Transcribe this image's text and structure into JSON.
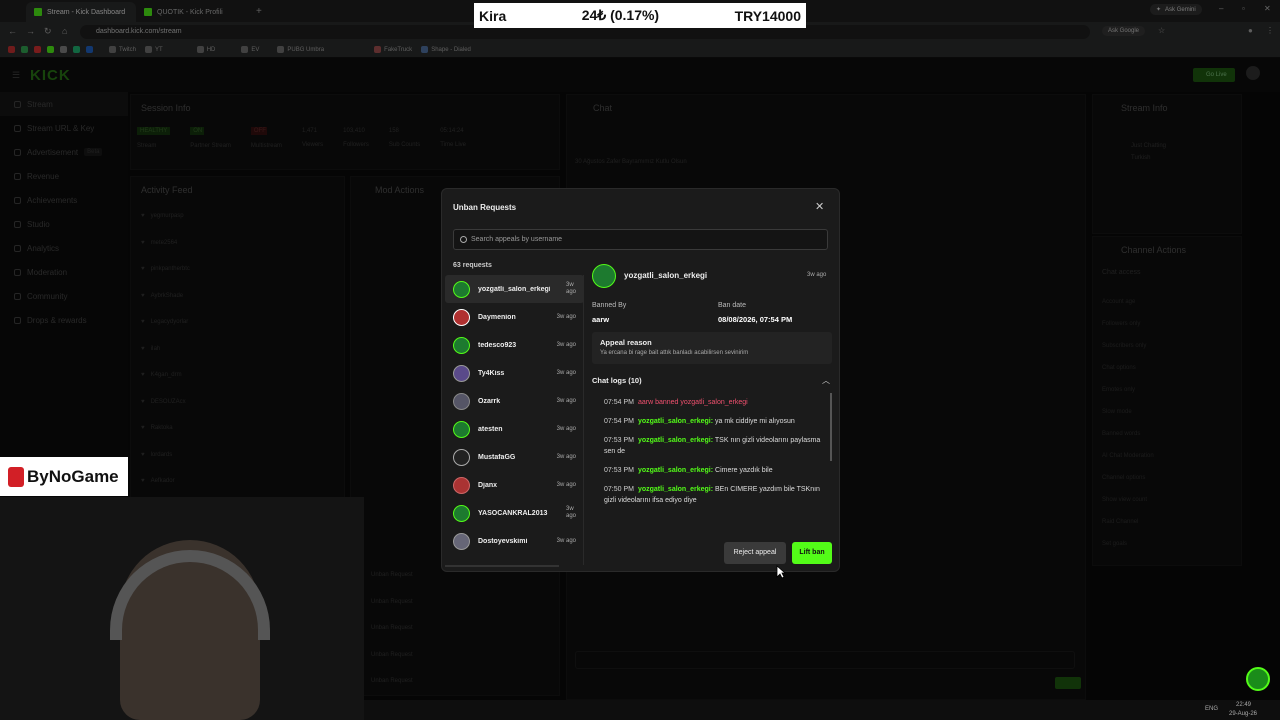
{
  "browser": {
    "tabs": [
      {
        "title": "Stream - Kick Dashboard",
        "active": true
      },
      {
        "title": "QUOTIK - Kick Profili",
        "active": false
      }
    ],
    "url": "dashboard.kick.com/stream",
    "ask_gemini": "Ask Gemini",
    "ask_google": "Ask Google",
    "bookmarks": [
      "Twitch",
      "YT",
      "HD",
      "EV",
      "PUBG Umbra",
      "FakeTruck",
      "Shape - Dialed"
    ]
  },
  "ticker": {
    "name": "Kira",
    "change": "24₺ (0.17%)",
    "amount": "TRY14000"
  },
  "dashboard": {
    "go_live": "Go Live",
    "sidebar": [
      {
        "label": "Stream",
        "selected": true
      },
      {
        "label": "Stream URL & Key",
        "selected": false
      },
      {
        "label": "Advertisement",
        "badge": "Beta",
        "selected": false
      },
      {
        "label": "Revenue",
        "selected": false
      },
      {
        "label": "Achievements",
        "selected": false
      },
      {
        "label": "Studio",
        "selected": false
      },
      {
        "label": "Analytics",
        "selected": false
      },
      {
        "label": "Moderation",
        "selected": false
      },
      {
        "label": "Community",
        "selected": false
      },
      {
        "label": "Drops & rewards",
        "selected": false
      }
    ],
    "session_info": {
      "title": "Session Info",
      "stats": [
        {
          "value": "HEALTHY",
          "label": "Stream"
        },
        {
          "value": "ON",
          "label": "Partner Stream"
        },
        {
          "value": "OFF",
          "label": "Multistream"
        },
        {
          "value": "1,471",
          "label": "Viewers"
        },
        {
          "value": "103,410",
          "label": "Followers"
        },
        {
          "value": "158",
          "label": "Sub Counts"
        },
        {
          "value": "05:14:24",
          "label": "Time Live"
        }
      ]
    },
    "activity_feed": {
      "title": "Activity Feed",
      "items": [
        "yegmurpasp",
        "mete2564",
        "pinkpantherbtc",
        "AybrkShade",
        "Legacydyorlar",
        "iIah",
        "K4gan_drm",
        "DESOUZAcx",
        "Raktoka",
        "lordards",
        "Aefkador"
      ]
    },
    "mod_actions": {
      "title": "Mod Actions",
      "item_label": "Unban Request",
      "mod": "GokhanOner"
    },
    "chat": {
      "title": "Chat",
      "announcement": "30 Ağustos Zafer Bayramımız Kutlu Olsun"
    },
    "stream_info": {
      "title": "Stream Info",
      "category": "Just Chatting",
      "language": "Turkish"
    },
    "channel_actions": {
      "title": "Channel Actions",
      "chat_access": "Chat access",
      "items": [
        "Account age",
        "Followers only",
        "Subscribers only",
        "Chat options",
        "Emotes only",
        "Slow mode",
        "Banned words",
        "AI Chat Moderation",
        "Channel options",
        "Show view count",
        "Raid Channel",
        "Set goals"
      ]
    }
  },
  "modal": {
    "title": "Unban Requests",
    "search_placeholder": "Search appeals by username",
    "request_count": "63 requests",
    "requests": [
      {
        "username": "yozgatli_salon_erkegi",
        "ago": "3w ago",
        "selected": true
      },
      {
        "username": "Daymenion",
        "ago": "3w ago",
        "selected": false
      },
      {
        "username": "tedesco923",
        "ago": "3w ago",
        "selected": false
      },
      {
        "username": "Ty4Kiss",
        "ago": "3w ago",
        "selected": false
      },
      {
        "username": "Ozarrk",
        "ago": "3w ago",
        "selected": false
      },
      {
        "username": "atesten",
        "ago": "3w ago",
        "selected": false
      },
      {
        "username": "MustafaGG",
        "ago": "3w ago",
        "selected": false
      },
      {
        "username": "Djanx",
        "ago": "3w ago",
        "selected": false
      },
      {
        "username": "YASOCANKRAL2013",
        "ago": "3w ago",
        "selected": false
      },
      {
        "username": "Dostoyevskimi",
        "ago": "3w ago",
        "selected": false
      }
    ],
    "detail": {
      "username": "yozgatli_salon_erkegi",
      "ago": "3w ago",
      "banned_by_label": "Banned By",
      "banned_by": "aarw",
      "ban_date_label": "Ban date",
      "ban_date": "08/08/2026, 07:54 PM",
      "appeal_reason_label": "Appeal reason",
      "appeal_reason": "Ya ercana bi rage bait attık banladı acabilirsen sevinirim",
      "chat_logs_label": "Chat logs (10)",
      "logs": [
        {
          "time": "07:54 PM",
          "user": "",
          "text": "aarw banned yozgatli_salon_erkegi",
          "ban": true
        },
        {
          "time": "07:54 PM",
          "user": "yozgatli_salon_erkegi:",
          "text": "ya mk ciddiye mi alıyosun",
          "ban": false
        },
        {
          "time": "07:53 PM",
          "user": "yozgatli_salon_erkegi:",
          "text": "TSK nın gizli videolarını paylasma sen de",
          "ban": false
        },
        {
          "time": "07:53 PM",
          "user": "yozgatli_salon_erkegi:",
          "text": "Cimere yazdık bile",
          "ban": false
        },
        {
          "time": "07:50 PM",
          "user": "yozgatli_salon_erkegi:",
          "text": "BEn CIMERE yazdım bile TSKnın gizli videolarını ifsa ediyo diye",
          "ban": false
        }
      ]
    },
    "reject_label": "Reject appeal",
    "lift_label": "Lift ban"
  },
  "overlay": {
    "bynogame": "ByNoGame"
  },
  "taskbar": {
    "lang": "ENG",
    "time": "22:49",
    "date": "29-Aug-26"
  },
  "colors": {
    "kick_green": "#53fc18",
    "ban_red": "#f0506e",
    "modal_bg": "#1b1b1b"
  }
}
